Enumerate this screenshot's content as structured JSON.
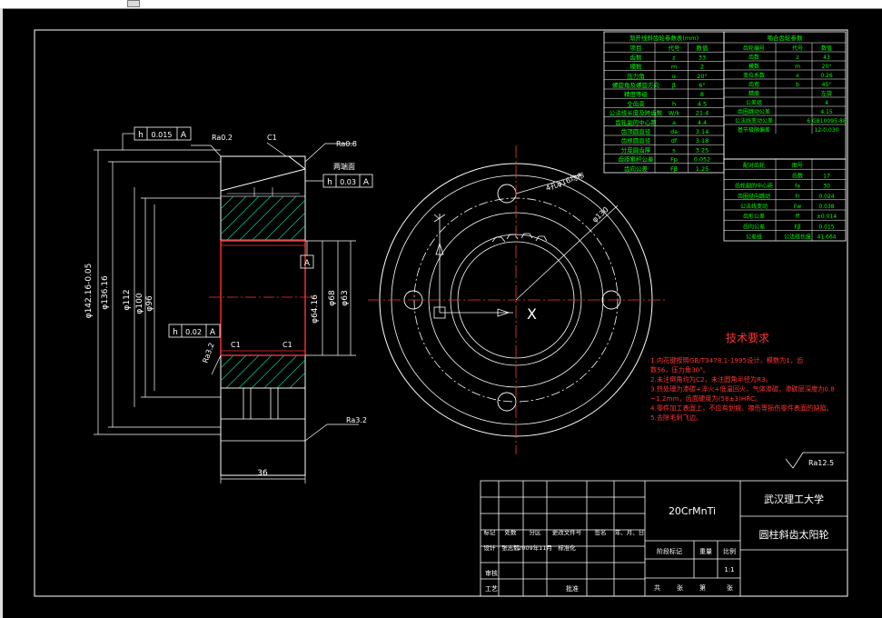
{
  "drawing": {
    "section_label": "两端面",
    "dims": {
      "tol_h_top": "h",
      "tol_val_top": "0.015",
      "tol_datum_top": "A",
      "tol_h_mid": "h",
      "tol_val_mid": "0.03",
      "tol_datum_mid": "A",
      "tol_h_low": "h",
      "tol_val_low": "0.02",
      "tol_datum_low": "A",
      "datum_bore": "A",
      "ra_top_left": "Ra0.2",
      "ra_top_right": "Ra0.8",
      "ra_left_low": "Ra3.2",
      "ra_bottom": "Ra3.2",
      "ra_global": "Ra12.5",
      "chamfer_c1_top": "C1",
      "chamfer_c1_low_l": "C1",
      "chamfer_c1_low_r": "C1",
      "dia_outer": "φ142.16-0.05",
      "dia_136": "φ136.16",
      "dia_112": "φ112",
      "dia_100": "φ100",
      "dia_96": "φ96",
      "dia_bore": "φ64.16",
      "dia_bore_r1": "φ68",
      "dia_bore_r2": "φ63",
      "width": "36",
      "hole_callout": "4孔φ16均布",
      "dia_circle": "φ130"
    }
  },
  "gear_table_left": {
    "header": "渐开线斜齿轮参数表(mm)",
    "rows": [
      [
        "项目",
        "代号",
        "数值"
      ],
      [
        "齿数",
        "z",
        "33"
      ],
      [
        "模数",
        "m",
        "2"
      ],
      [
        "压力角",
        "α",
        "20°"
      ],
      [
        "螺旋角及螺旋方向",
        "β",
        "6°"
      ],
      [
        "精度等级",
        "",
        "8"
      ],
      [
        "全齿高",
        "h",
        "4.5"
      ],
      [
        "公法线长度及跨齿数",
        "W/k",
        "21.4"
      ],
      [
        "齿轮副的中心距",
        "a",
        "4.4"
      ],
      [
        "齿顶圆直径",
        "da",
        "3.14"
      ],
      [
        "齿根圆直径",
        "df",
        "3.18"
      ],
      [
        "分度圆齿厚",
        "s",
        "3.25"
      ],
      [
        "齿距累积公差",
        "Fp",
        "0.052"
      ],
      [
        "齿向公差",
        "Fβ",
        "1.25"
      ]
    ]
  },
  "gear_table_right": {
    "header": "啮合齿轮参数",
    "rows": [
      [
        "齿轮编号",
        "代号",
        "数值"
      ],
      [
        "齿数",
        "z",
        "43"
      ],
      [
        "模数",
        "m",
        "20°"
      ],
      [
        "变位系数",
        "x",
        "0.26"
      ],
      [
        "齿宽",
        "b",
        "45°"
      ],
      [
        "精度",
        "",
        "左旋"
      ],
      [
        "公差组",
        "",
        "4"
      ],
      [
        "齿圈跳动公差",
        "",
        "4.15"
      ],
      [
        "公法线变动公差",
        "",
        "6 GB10095-88"
      ],
      [
        "基节极限偏差",
        "",
        "12-0.030"
      ]
    ]
  },
  "gear_table_bottom": {
    "rows": [
      [
        "配对齿轮",
        "图号",
        ""
      ],
      [
        "",
        "齿数",
        "17"
      ],
      [
        "齿轮副的中心距",
        "fa",
        "30"
      ],
      [
        "齿圈径向跳动",
        "Fr",
        "0.024"
      ],
      [
        "公法线变动",
        "Fw",
        "0.038"
      ],
      [
        "齿形公差",
        "ff",
        "±0.014"
      ],
      [
        "齿向公差",
        "Fβ",
        "0.015"
      ],
      [
        "公差组",
        "公法线长度",
        "41.664"
      ]
    ]
  },
  "tech_req": {
    "title": "技术要求",
    "items": [
      "1.内花键按照GB/T3478.1-1995设计，模数为1，齿数56，压力角30°。",
      "2.未注倒角均为C2，未注圆角半径为R3。",
      "3.热处理为渗碳+淬火+低温回火，气体渗碳，渗碳层深度为0.8~1.2mm，齿面硬度为(58±3)HRC。",
      "4.零件加工表面上，不应有划痕、擦伤等损伤零件表面的缺陷。",
      "5.去除毛刺飞边。"
    ]
  },
  "title_block": {
    "material": "20CrMnTi",
    "school": "武汉理工大学",
    "part_name": "圆柱斜齿太阳轮",
    "labels_row1": [
      "标记",
      "处数",
      "分区",
      "更改文件号",
      "签名",
      "年、月、日"
    ],
    "labels_row2": [
      "设计",
      "张志毅",
      "2009年11月",
      "标准化"
    ],
    "stage_label": "阶段标记",
    "weight_label": "重量",
    "scale_label": "比例",
    "scale_value": "1:1",
    "review": "审核",
    "process": "工艺",
    "approve": "批准",
    "sheets_total": "共",
    "sheets_zhang": "张",
    "sheets_di": "第",
    "sheets_zhang2": "张"
  }
}
